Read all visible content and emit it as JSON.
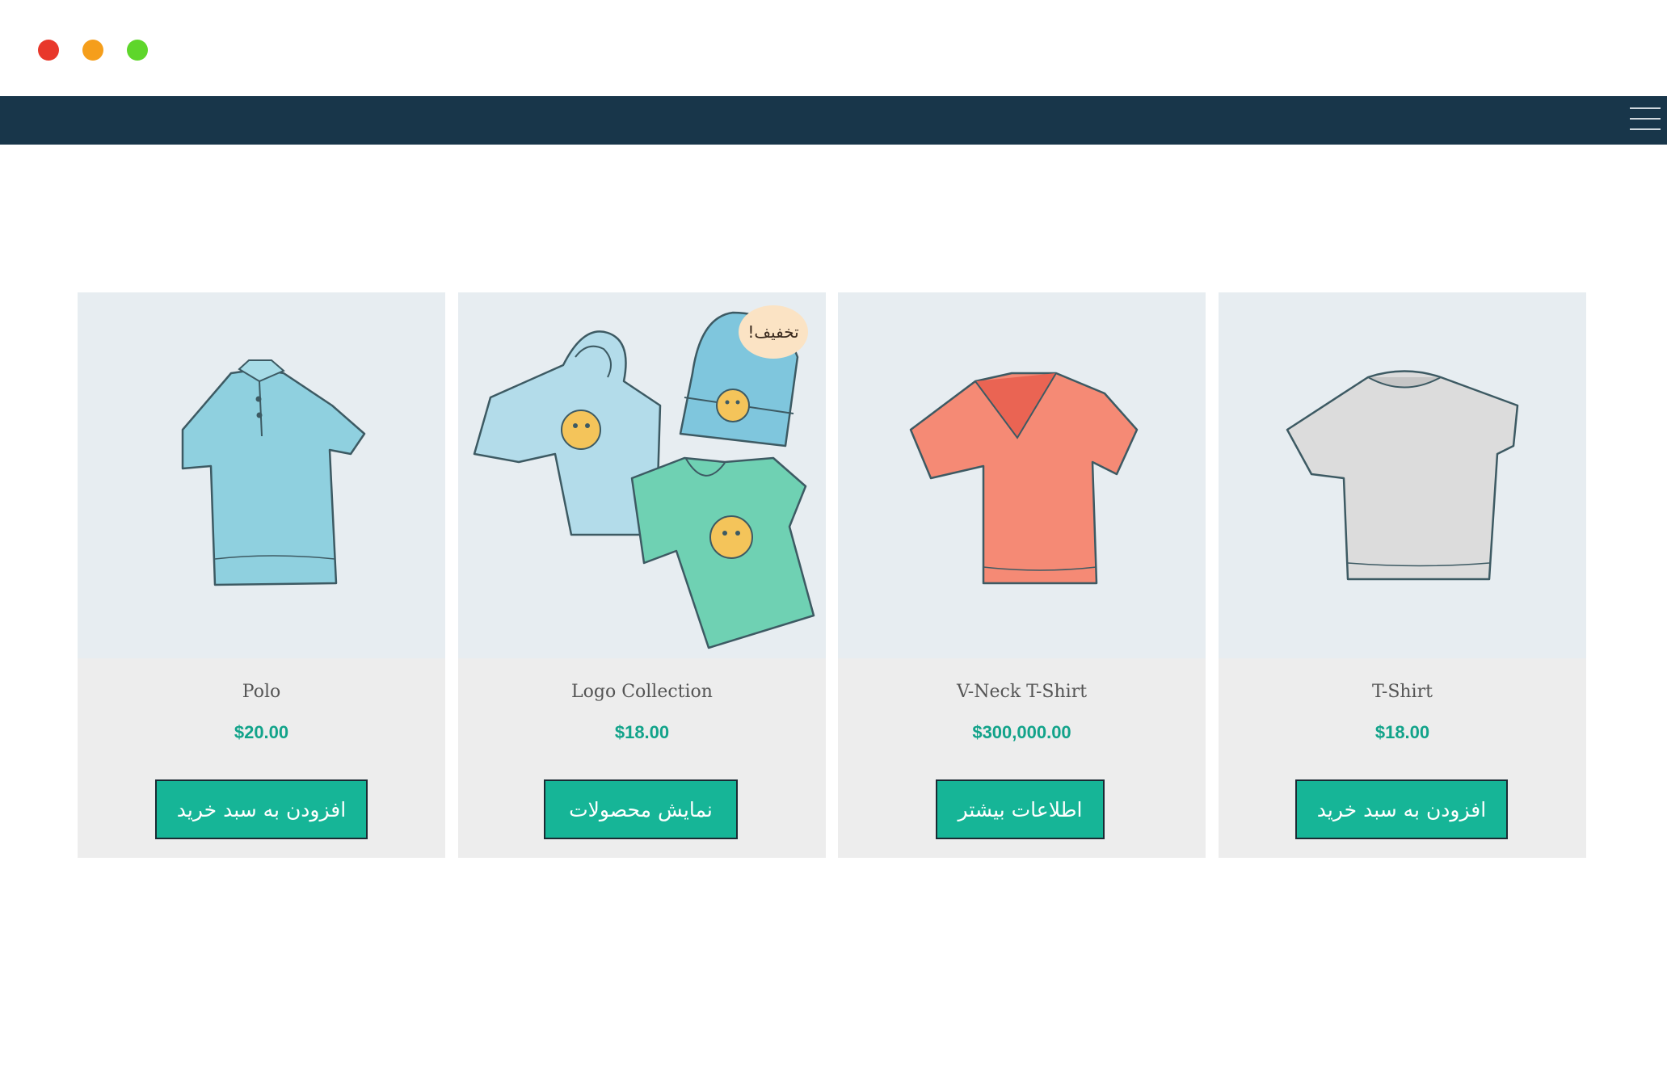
{
  "window": {
    "controls": [
      "close",
      "minimize",
      "maximize"
    ]
  },
  "navbar": {
    "menu_icon": "hamburger-menu-icon",
    "background": "#18364a"
  },
  "colors": {
    "accent": "#16b597",
    "price": "#12a38a",
    "card_bg": "#ededed",
    "badge_bg": "#fbe3c4"
  },
  "products": [
    {
      "name": "Polo",
      "price": "$20.00",
      "button": "افزودن به سبد خرید",
      "image": "polo-shirt-illustration"
    },
    {
      "name": "Logo Collection",
      "price": "$18.00",
      "button": "نمایش محصولات",
      "image": "logo-collection-illustration",
      "badge": "تخفیف!"
    },
    {
      "name": "V-Neck T-Shirt",
      "price": "$300,000.00",
      "button": "اطلاعات بیشتر",
      "image": "vneck-tshirt-illustration"
    },
    {
      "name": "T-Shirt",
      "price": "$18.00",
      "button": "افزودن به سبد خرید",
      "image": "tshirt-illustration"
    }
  ]
}
